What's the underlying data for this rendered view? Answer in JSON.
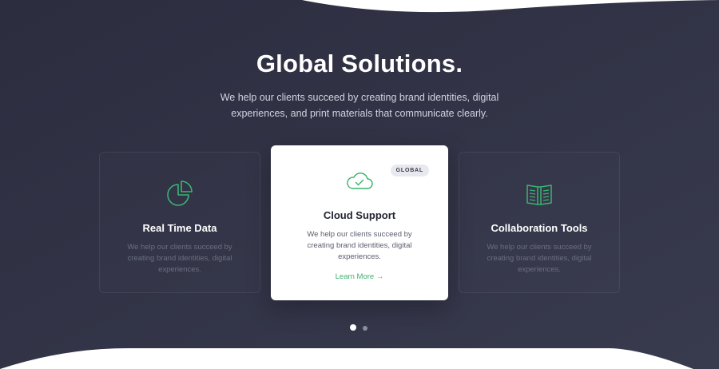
{
  "section": {
    "title": "Global Solutions.",
    "subtitle": "We help our clients succeed by creating brand identities, digital experiences, and print materials that communicate clearly."
  },
  "cards": [
    {
      "icon": "pie-chart-icon",
      "title": "Real Time Data",
      "text": "We help our clients succeed by creating brand identities, digital experiences."
    },
    {
      "icon": "cloud-check-icon",
      "badge": "GLOBAL",
      "title": "Cloud Support",
      "text": "We help our clients succeed by creating brand identities, digital experiences.",
      "link": "Learn More →"
    },
    {
      "icon": "open-book-icon",
      "title": "Collaboration Tools",
      "text": "We help our clients succeed by creating brand identities, digital experiences."
    }
  ],
  "carousel": {
    "active_index": 0,
    "count": 2
  },
  "colors": {
    "background": "#2f3042",
    "accent": "#3cb371",
    "card_light": "#ffffff"
  }
}
